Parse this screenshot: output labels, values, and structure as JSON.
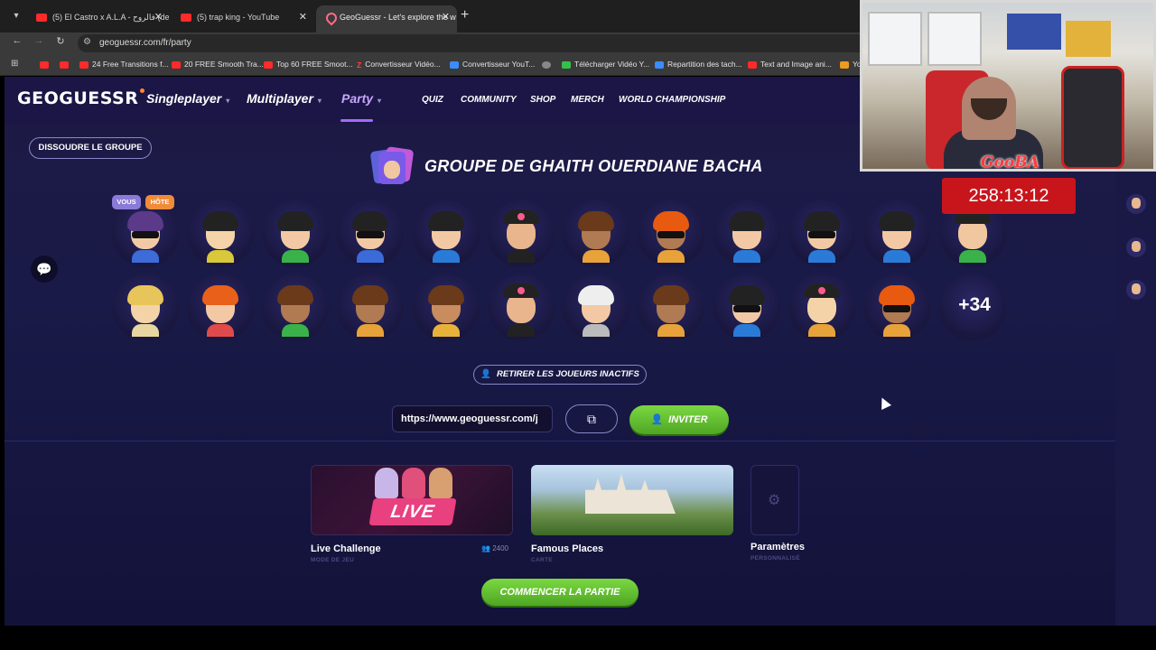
{
  "browser": {
    "tabs": [
      {
        "title": "(5) El Castro x A.L.A - فالروح (de",
        "close": "✕"
      },
      {
        "title": "(5) trap king - YouTube",
        "close": "✕"
      },
      {
        "title": "GeoGuessr - Let's explore the w",
        "close": "✕"
      }
    ],
    "new_tab": "+",
    "url": "geoguessr.com/fr/party",
    "bookmarks": [
      "24 Free Transitions f...",
      "20 FREE Smooth Tra...",
      "Top 60 FREE Smoot...",
      "Convertisseur Vidéo...",
      "Convertisseur YouT...",
      "Télécharger Vidéo Y...",
      "Repartition des tach...",
      "Text and Image ani...",
      "Yo"
    ]
  },
  "nav": {
    "logo": "GEOGUESSR",
    "main": [
      {
        "label": "Singleplayer"
      },
      {
        "label": "Multiplayer"
      },
      {
        "label": "Party"
      }
    ],
    "sub": [
      "QUIZ",
      "COMMUNITY",
      "SHOP",
      "MERCH",
      "WORLD CHAMPIONSHIP"
    ]
  },
  "party": {
    "dissolve_label": "DISSOUDRE LE GROUPE",
    "title": "GROUPE DE GHAITH OUERDIANE BACHA",
    "badge_you": "VOUS",
    "badge_host": "HÔTE",
    "more_count": "+34",
    "kick_label": "RETIRER LES JOUEURS INACTIFS",
    "invite_link": "https://www.geoguessr.com/j",
    "invite_label": "INVITER",
    "start_label": "COMMENCER LA PARTIE"
  },
  "modes": [
    {
      "name": "Live Challenge",
      "sub": "MODE DE JEU",
      "count": "2400",
      "tag": "LIVE"
    },
    {
      "name": "Famous Places",
      "sub": "CARTE"
    },
    {
      "name": "Paramètres",
      "sub": "PERSONNALISÉ"
    }
  ],
  "stream": {
    "streamer": "GooBA",
    "timer": "258:13:12"
  },
  "colors": {
    "accent": "#a26bff",
    "green": "#5cbf2a",
    "live": "#e9407f",
    "timer_bg": "#c8151c"
  },
  "icons": [
    "menu-icon",
    "back-icon",
    "forward-icon",
    "reload-icon",
    "tune-icon",
    "chat-icon",
    "user-remove-icon",
    "copy-icon",
    "add-user-icon",
    "gear-icon",
    "people-icon"
  ]
}
